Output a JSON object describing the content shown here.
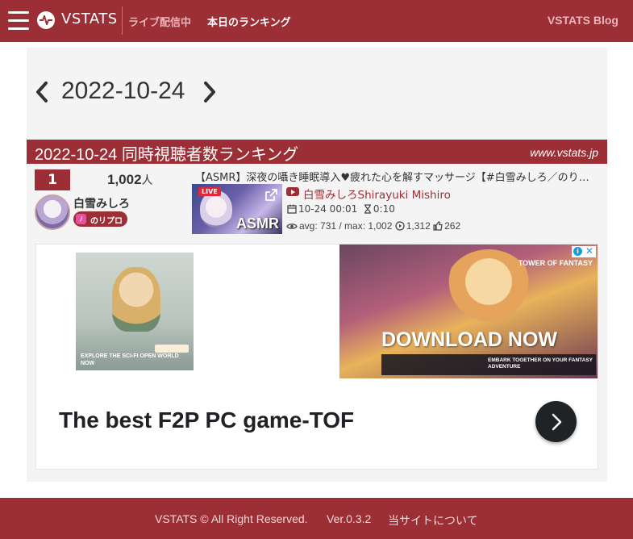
{
  "header": {
    "brand": "VSTATS",
    "nav_live": "ライブ配信中",
    "nav_ranking": "本日のランキング",
    "nav_blog": "VSTATS Blog",
    "icons": [
      "menu-icon",
      "vstats-logo-icon"
    ]
  },
  "date_nav": {
    "date": "2022-10-24"
  },
  "ranking": {
    "title": "2022-10-24 同時視聴者数ランキング",
    "site": "www.vstats.jp",
    "entries": [
      {
        "rank": "1",
        "viewers": "1,002",
        "viewers_unit": "人",
        "streamer": "白雪みしろ",
        "agency": "のリプロ",
        "agency_icon_text": "ﾉ",
        "stream_title": "【ASMR】深夜の囁き睡眠導入♥疲れた心を解すマッサージ【#白雪みしろ／のりプロ所属】",
        "thumb_live": "LIVE",
        "thumb_text": "ASMR",
        "channel": "白雪みしろShirayuki Mishiro",
        "start": "10-24 00:01",
        "duration": "0:10",
        "avg_max": "avg: 731 / max: 1,002",
        "views": "1,312",
        "likes": "262"
      }
    ]
  },
  "ad": {
    "headline": "The best F2P PC game-TOF",
    "download": "DOWNLOAD NOW",
    "left_text": "EXPLORE THE SCI-FI OPEN WORLD NOW",
    "brand_small": "TOWER OF FANTASY",
    "strip_text": "EMBARK TOGETHER ON YOUR FANTASY ADVENTURE"
  },
  "footer": {
    "copyright": "VSTATS © All Right Reserved.",
    "version": "Ver.0.3.2",
    "about": "当サイトについて"
  },
  "colors": {
    "brand": "#9c2e35",
    "panel": "#f4f4f4"
  }
}
